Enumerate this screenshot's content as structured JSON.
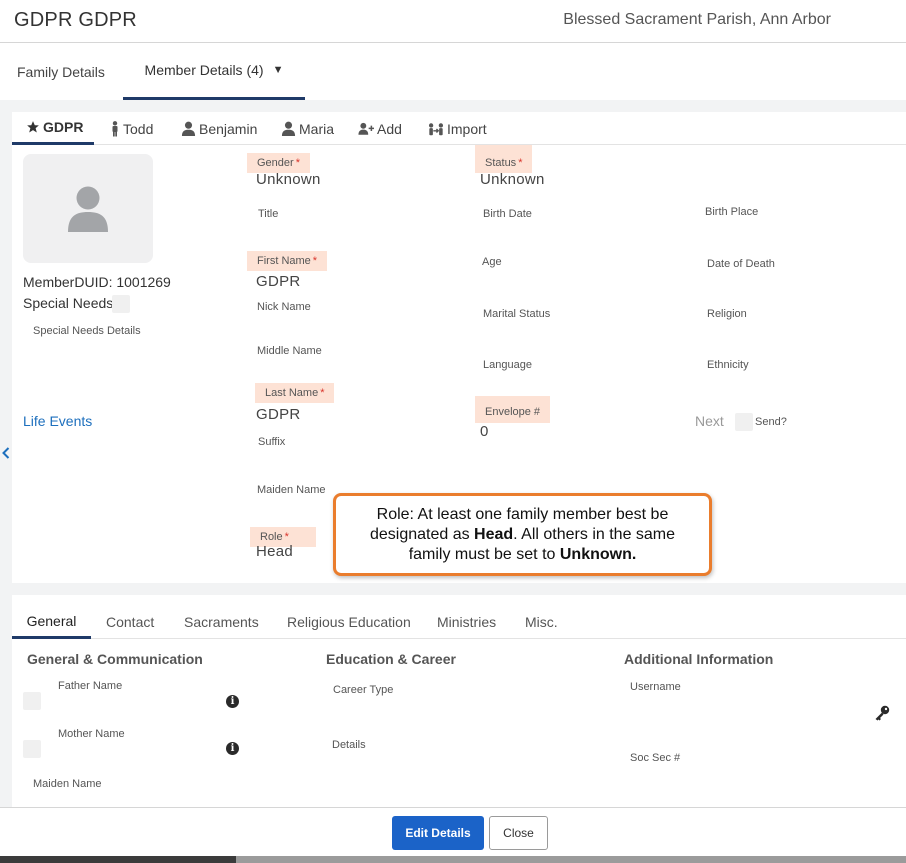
{
  "header": {
    "title": "GDPR GDPR",
    "parish": "Blessed Sacrament Parish, Ann Arbor"
  },
  "top_tabs": {
    "family": "Family Details",
    "member": "Member Details (4)",
    "member_caret": "▼"
  },
  "member_tabs": [
    {
      "label": "GDPR",
      "icon": "star-icon"
    },
    {
      "label": "Todd",
      "icon": "person-standing-icon"
    },
    {
      "label": "Benjamin",
      "icon": "person-icon"
    },
    {
      "label": "Maria",
      "icon": "person-icon"
    },
    {
      "label": "Add",
      "icon": "add-person-icon"
    },
    {
      "label": "Import",
      "icon": "import-people-icon"
    }
  ],
  "member_info": {
    "duid": "MemberDUID: 1001269",
    "special_needs": "Special Needs",
    "special_needs_details": "Special Needs Details",
    "life_events": "Life Events"
  },
  "fields": {
    "gender": {
      "label": "Gender",
      "value": "Unknown"
    },
    "title": {
      "label": "Title"
    },
    "first_name": {
      "label": "First Name",
      "value": "GDPR"
    },
    "nick_name": {
      "label": "Nick Name"
    },
    "middle_name": {
      "label": "Middle Name"
    },
    "last_name": {
      "label": "Last Name",
      "value": "GDPR"
    },
    "suffix": {
      "label": "Suffix"
    },
    "maiden_name": {
      "label": "Maiden Name"
    },
    "role": {
      "label": "Role",
      "value": "Head"
    },
    "status": {
      "label": "Status",
      "value": "Unknown"
    },
    "birth_date": {
      "label": "Birth Date"
    },
    "age": {
      "label": "Age"
    },
    "marital_status": {
      "label": "Marital Status"
    },
    "language": {
      "label": "Language"
    },
    "envelope": {
      "label": "Envelope #",
      "value": "0"
    },
    "birth_place": {
      "label": "Birth Place"
    },
    "date_of_death": {
      "label": "Date of Death"
    },
    "religion": {
      "label": "Religion"
    },
    "ethnicity": {
      "label": "Ethnicity"
    },
    "next": "Next",
    "send": "Send?"
  },
  "required_star": "*",
  "callout": {
    "part1": "Role: At least one family member best be designated as ",
    "bold1": "Head",
    "part2": ". All others in the same family must be set to ",
    "bold2": "Unknown."
  },
  "lower_tabs": [
    "General",
    "Contact",
    "Sacraments",
    "Religious Education",
    "Ministries",
    "Misc."
  ],
  "sections": {
    "general": {
      "heading": "General & Communication",
      "father_name": "Father Name",
      "mother_name": "Mother Name",
      "maiden_name": "Maiden Name"
    },
    "education": {
      "heading": "Education & Career",
      "career_type": "Career Type",
      "details": "Details"
    },
    "additional": {
      "heading": "Additional Information",
      "username": "Username",
      "soc_sec": "Soc Sec #"
    }
  },
  "footer": {
    "edit": "Edit Details",
    "close": "Close"
  },
  "colors": {
    "accent": "#1f3a68",
    "primary_button": "#1b63c8",
    "required_highlight": "#fde2d5",
    "callout_border": "#ea7d2d",
    "link": "#1d6fbd"
  }
}
